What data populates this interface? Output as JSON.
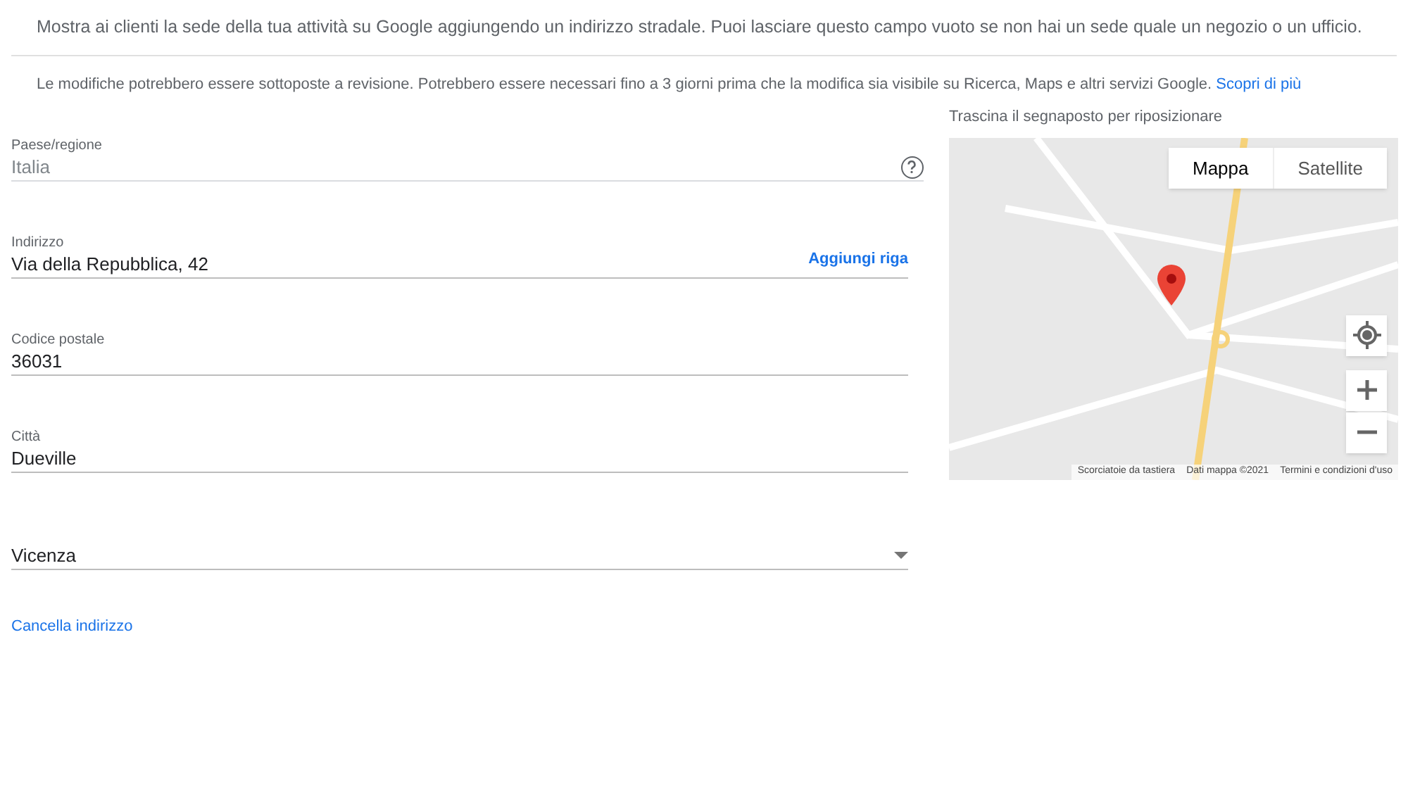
{
  "intro": "Mostra ai clienti la sede della tua attività su Google aggiungendo un indirizzo stradale. Puoi lasciare questo campo vuoto se non hai un sede quale un negozio o un ufficio.",
  "notice": {
    "text": "Le modifiche potrebbero essere sottoposte a revisione. Potrebbero essere necessari fino a 3 giorni prima che la modifica sia visibile su Ricerca, Maps e altri servizi Google.",
    "link": "Scopri di più"
  },
  "fields": [
    {
      "kind": "help",
      "label": "Paese/regione",
      "value": "Italia",
      "disabled": true
    },
    {
      "kind": "add_line",
      "label": "Indirizzo",
      "value": "Via della Repubblica, 42",
      "action": "Aggiungi riga",
      "disabled": false
    },
    {
      "kind": "text",
      "label": "Codice postale",
      "value": "36031",
      "disabled": false
    },
    {
      "kind": "text",
      "label": "Città",
      "value": "Dueville",
      "disabled": false
    },
    {
      "kind": "select",
      "value": "Vicenza",
      "disabled": false
    }
  ],
  "remove_link": "Cancella indirizzo",
  "map": {
    "hint": "Trascina il segnaposto per riposizionare",
    "map_types": [
      {
        "label": "Mappa",
        "selected": true
      },
      {
        "label": "Satellite",
        "selected": false
      }
    ],
    "footer": [
      "Scorciatoie da tastiera",
      "Dati mappa ©2021",
      "Termini e condizioni d'uso"
    ]
  }
}
